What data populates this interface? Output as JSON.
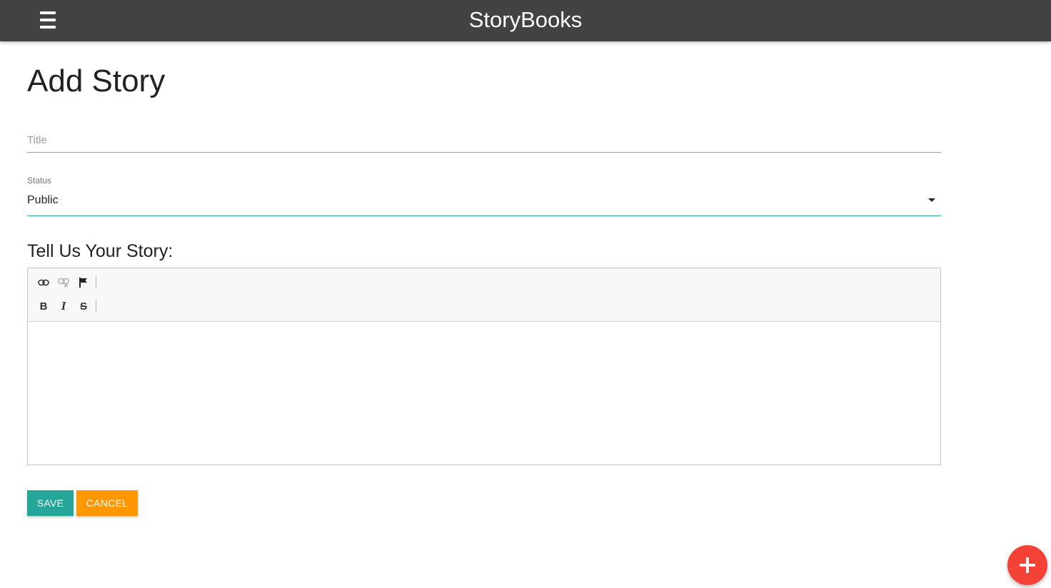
{
  "navbar": {
    "brand": "StoryBooks",
    "menu_icon": "hamburger-menu-icon",
    "background": "#424242"
  },
  "page": {
    "title": "Add Story"
  },
  "form": {
    "title_field": {
      "placeholder": "Title",
      "value": ""
    },
    "status_field": {
      "label": "Status",
      "selected": "Public"
    },
    "story_heading": "Tell Us Your Story:",
    "editor": {
      "toolbar_row1": [
        {
          "icon": "link-icon",
          "glyph": "",
          "enabled": true
        },
        {
          "icon": "unlink-icon",
          "glyph": "",
          "enabled": false
        },
        {
          "icon": "anchor-flag-icon",
          "glyph": "",
          "enabled": true
        }
      ],
      "toolbar_row2": [
        {
          "icon": "bold-icon",
          "glyph": "B",
          "enabled": true
        },
        {
          "icon": "italic-icon",
          "glyph": "I",
          "enabled": true
        },
        {
          "icon": "strikethrough-icon",
          "glyph": "S",
          "enabled": true
        }
      ],
      "content": ""
    },
    "buttons": {
      "save": "SAVE",
      "cancel": "CANCEL"
    }
  },
  "colors": {
    "accent_teal": "#26a69a",
    "cancel_orange": "#ff9800",
    "fab_red": "#f44336"
  },
  "fab": {
    "icon": "plus-icon"
  }
}
